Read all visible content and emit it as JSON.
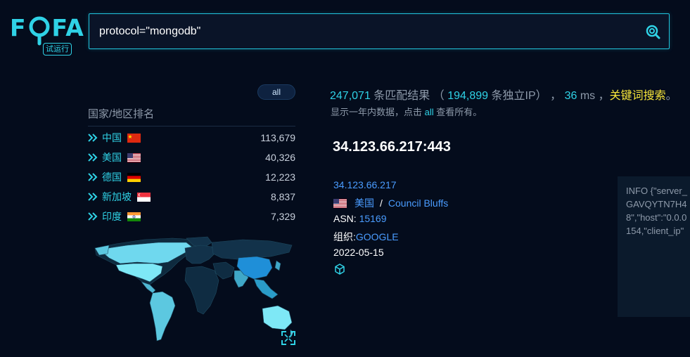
{
  "logo": {
    "text_f": "F",
    "text_fa": "FA",
    "badge": "试运行"
  },
  "search": {
    "query": "protocol=\"mongodb\"",
    "icon": "search-icon"
  },
  "filter": {
    "all_label": "all"
  },
  "ranking": {
    "title": "国家/地区排名",
    "items": [
      {
        "country": "中国",
        "count": "113,679",
        "flag": "cn"
      },
      {
        "country": "美国",
        "count": "40,326",
        "flag": "us"
      },
      {
        "country": "德国",
        "count": "12,223",
        "flag": "de"
      },
      {
        "country": "新加坡",
        "count": "8,837",
        "flag": "sg"
      },
      {
        "country": "印度",
        "count": "7,329",
        "flag": "in"
      }
    ]
  },
  "stats": {
    "match_count": "247,071",
    "match_label": "条匹配结果",
    "open_paren": "（",
    "ip_count": "194,899",
    "ip_label": "条独立IP）",
    "sep1": "，",
    "ms": "36",
    "ms_label": "ms",
    "sep2": "，",
    "keyword_search": "关键词搜索",
    "end": "。",
    "sub_prefix": "显示一年内数据，点击",
    "sub_link": "all",
    "sub_suffix": "查看所有。"
  },
  "result": {
    "host": "34.123.66.217:443",
    "ip": "34.123.66.217",
    "country": "美国",
    "slash": "/",
    "city": "Council Bluffs",
    "asn_label": "ASN:",
    "asn": "15169",
    "org_label": "组织:",
    "org": "GOOGLE",
    "date": "2022-05-15"
  },
  "info_panel": {
    "lines": [
      "INFO {\"server_",
      "GAVQYTN7H4",
      "8\",\"host\":\"0.0.0",
      "154,\"client_ip\""
    ]
  },
  "colors": {
    "accent": "#2fd2e6",
    "keyword": "#f7e53a",
    "link": "#4a9cff",
    "background": "#040c1c"
  }
}
